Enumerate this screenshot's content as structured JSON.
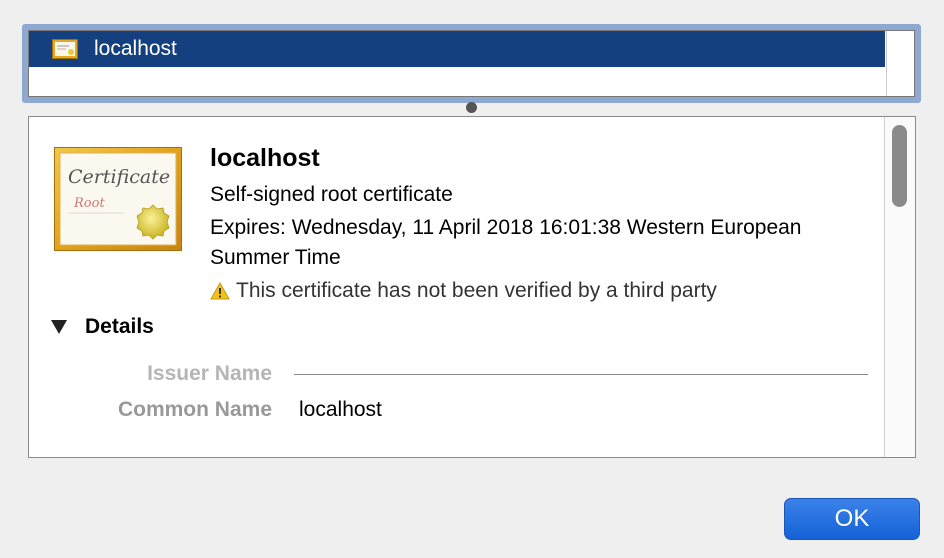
{
  "list": {
    "items": [
      {
        "label": "localhost",
        "icon": "certificate-icon",
        "selected": true
      }
    ],
    "selection_color": "#15407f"
  },
  "detail": {
    "certificate_icon": {
      "icon": "certificate-icon",
      "script_line1": "Certificate",
      "script_line2": "Root"
    },
    "title": "localhost",
    "subtitle": "Self-signed root certificate",
    "expires": "Expires: Wednesday, 11 April 2018 16:01:38 Western European Summer Time",
    "warning_icon": "warning-icon",
    "warning": "This certificate has not been verified by a third party",
    "details_label": "Details",
    "fields": {
      "issuer_name_label": "Issuer Name",
      "common_name_label": "Common Name",
      "common_name_value": "localhost"
    }
  },
  "buttons": {
    "ok_label": "OK",
    "ok_color": "#1462d6"
  }
}
